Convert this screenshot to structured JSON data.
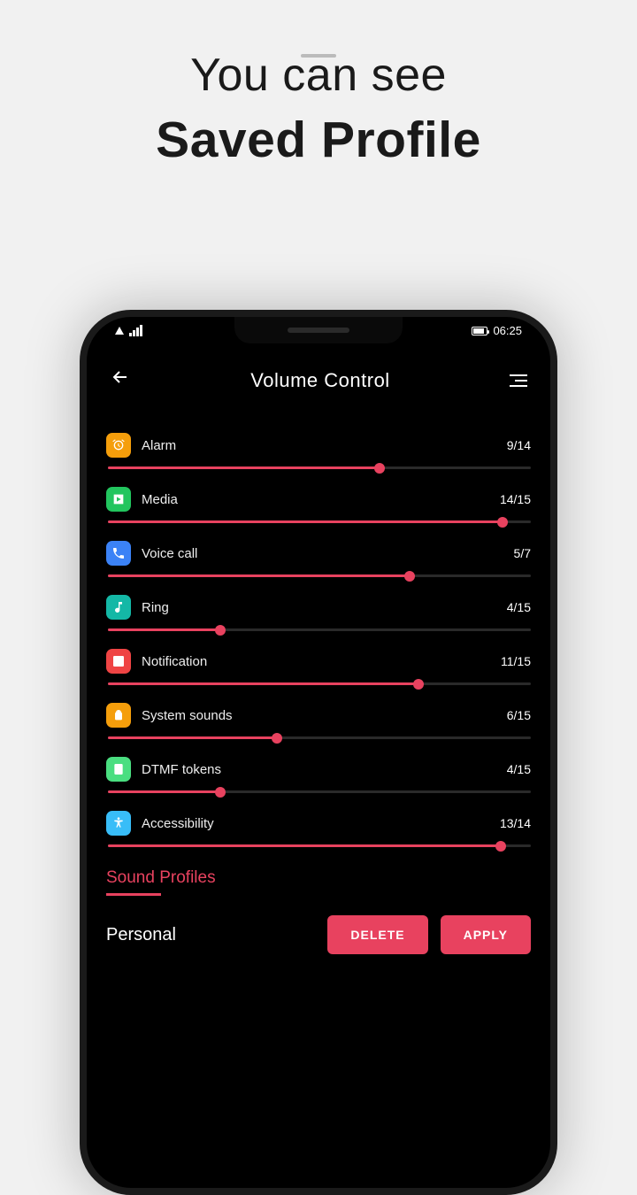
{
  "promo": {
    "line1": "You can see",
    "line2": "Saved Profile"
  },
  "status": {
    "time": "06:25"
  },
  "header": {
    "title": "Volume Control"
  },
  "sliders": [
    {
      "id": "alarm",
      "label": "Alarm",
      "value": 9,
      "max": 14,
      "display": "9/14",
      "icon": "alarm-icon",
      "color": "bg-orange"
    },
    {
      "id": "media",
      "label": "Media",
      "value": 14,
      "max": 15,
      "display": "14/15",
      "icon": "media-icon",
      "color": "bg-green"
    },
    {
      "id": "voice-call",
      "label": "Voice call",
      "value": 5,
      "max": 7,
      "display": "5/7",
      "icon": "phone-icon",
      "color": "bg-blue"
    },
    {
      "id": "ring",
      "label": "Ring",
      "value": 4,
      "max": 15,
      "display": "4/15",
      "icon": "music-icon",
      "color": "bg-teal"
    },
    {
      "id": "notification",
      "label": "Notification",
      "value": 11,
      "max": 15,
      "display": "11/15",
      "icon": "notification-icon",
      "color": "bg-red"
    },
    {
      "id": "system-sounds",
      "label": "System sounds",
      "value": 6,
      "max": 15,
      "display": "6/15",
      "icon": "android-icon",
      "color": "bg-amber"
    },
    {
      "id": "dtmf-tokens",
      "label": "DTMF tokens",
      "value": 4,
      "max": 15,
      "display": "4/15",
      "icon": "dtmf-icon",
      "color": "bg-lime"
    },
    {
      "id": "accessibility",
      "label": "Accessibility",
      "value": 13,
      "max": 14,
      "display": "13/14",
      "icon": "accessibility-icon",
      "color": "bg-sky"
    }
  ],
  "profiles": {
    "section_label": "Sound Profiles",
    "current": "Personal",
    "delete_label": "DELETE",
    "apply_label": "APPLY"
  }
}
